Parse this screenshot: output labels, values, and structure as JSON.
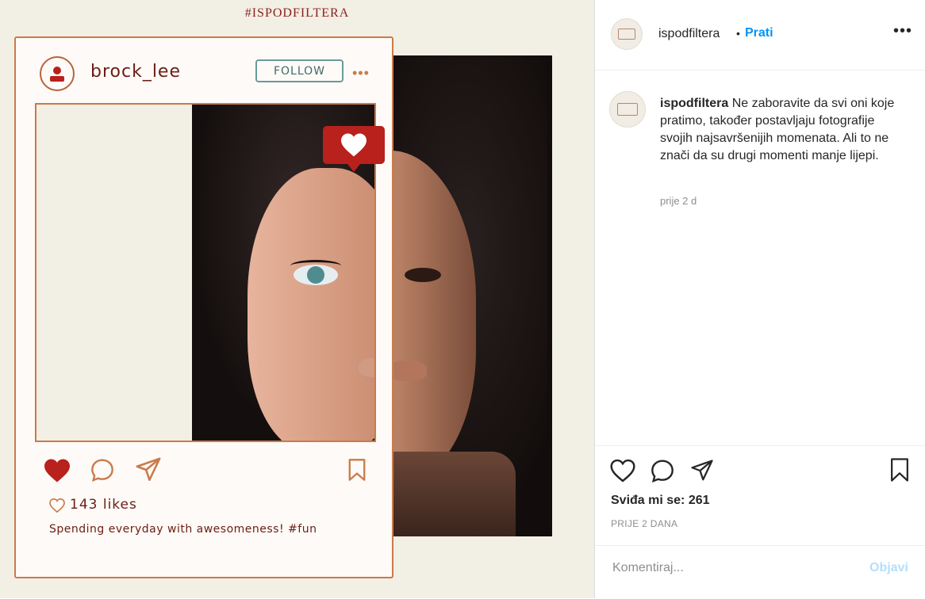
{
  "colors": {
    "accent_blue": "#0095f6",
    "post_disabled": "#b2dffc",
    "frame_border": "#c97b4a",
    "frame_text": "#6b1d14",
    "heart_red": "#b8211c",
    "follow_teal": "#6a9a98"
  },
  "image": {
    "hashtag": "#ISPODFILTERA",
    "frame": {
      "username": "brock_lee",
      "follow_label": "FOLLOW",
      "more": "•••",
      "likes": "143 likes",
      "caption": "Spending everyday with awesomeness! #fun"
    }
  },
  "header": {
    "username": "ispodfiltera",
    "separator": "•",
    "follow_label": "Prati",
    "more": "•••"
  },
  "comment": {
    "username": "ispodfiltera",
    "text": "Ne zaboravite da svi oni koje pratimo, također postavljaju fotografije svojih najsavršenijih momenata. Ali to ne znači da su drugi momenti manje lijepi.",
    "time": "prije 2 d"
  },
  "actions": {
    "likes_text": "Sviđa mi se: 261",
    "time_text": "PRIJE 2 DANA"
  },
  "comment_box": {
    "placeholder": "Komentiraj...",
    "post_label": "Objavi"
  },
  "icons": [
    "heart-icon",
    "comment-icon",
    "share-icon",
    "bookmark-icon",
    "more-icon",
    "user-icon"
  ]
}
